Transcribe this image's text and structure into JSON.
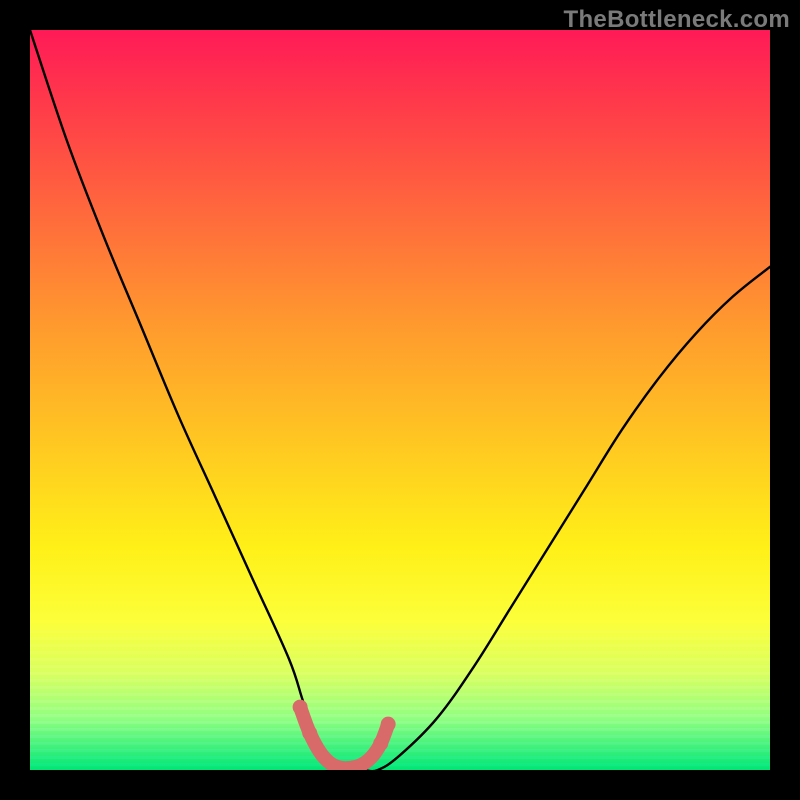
{
  "watermark": "TheBottleneck.com",
  "chart_data": {
    "type": "line",
    "title": "",
    "xlabel": "",
    "ylabel": "",
    "xlim": [
      0,
      100
    ],
    "ylim": [
      0,
      100
    ],
    "series": [
      {
        "name": "bottleneck-curve",
        "x": [
          0,
          5,
          10,
          15,
          20,
          25,
          30,
          35,
          37,
          39,
          41,
          43,
          45,
          47,
          50,
          55,
          60,
          65,
          70,
          75,
          80,
          85,
          90,
          95,
          100
        ],
        "y": [
          100,
          85,
          72,
          60,
          48,
          37,
          26,
          15,
          9,
          4,
          1,
          0,
          0,
          0,
          2,
          7,
          14,
          22,
          30,
          38,
          46,
          53,
          59,
          64,
          68
        ]
      }
    ],
    "highlight": {
      "name": "valley-marker",
      "x": [
        36.5,
        37.8,
        39.2,
        40.6,
        42.0,
        43.4,
        44.8,
        46.2,
        47.4,
        48.4
      ],
      "y": [
        8.5,
        5.0,
        2.4,
        0.9,
        0.3,
        0.3,
        0.7,
        1.8,
        3.6,
        6.2
      ]
    }
  }
}
